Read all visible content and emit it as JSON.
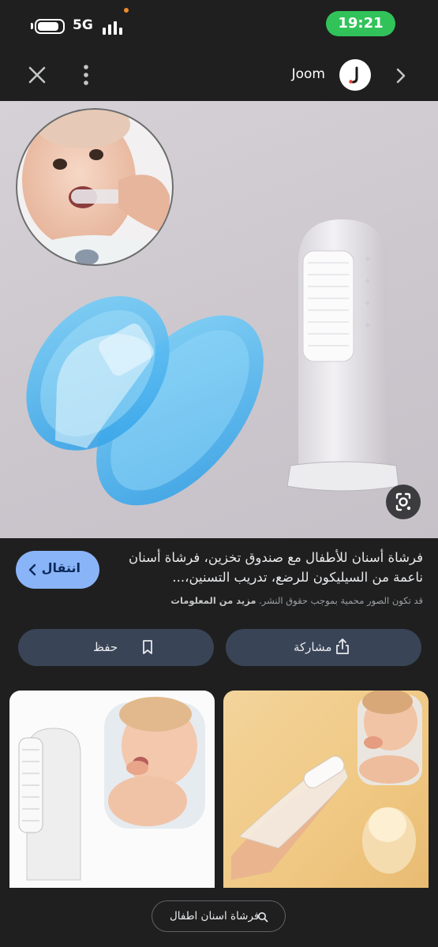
{
  "status_bar": {
    "network": "5G",
    "time": "19:21"
  },
  "top_bar": {
    "site_name": "Joom"
  },
  "result": {
    "title": "فرشاة أسنان للأطفال مع صندوق تخزين، فرشاة أسنان ناعمة من السيليكون للرضع، تدريب التسنين،...",
    "copyright_notice": "قد تكون الصور محمية بموجب حقوق النشر.",
    "more_info_link": "مزيد من المعلومات",
    "visit_label": "انتقال"
  },
  "actions": {
    "share_label": "مشاركة",
    "save_label": "حفظ"
  },
  "search_chip": {
    "query": "فرشاة اسنان اطفال"
  },
  "colors": {
    "background": "#1f1f1f",
    "visit_button": "#8ab4f8",
    "action_button": "#394457",
    "time_pill": "#32c25a",
    "brush_case": "#47b7ef"
  },
  "icons": [
    "close-icon",
    "more-vert-icon",
    "joom-logo",
    "chevron-right-icon",
    "google-lens-icon",
    "chevron-left-icon",
    "share-icon",
    "bookmark-icon",
    "search-icon"
  ]
}
